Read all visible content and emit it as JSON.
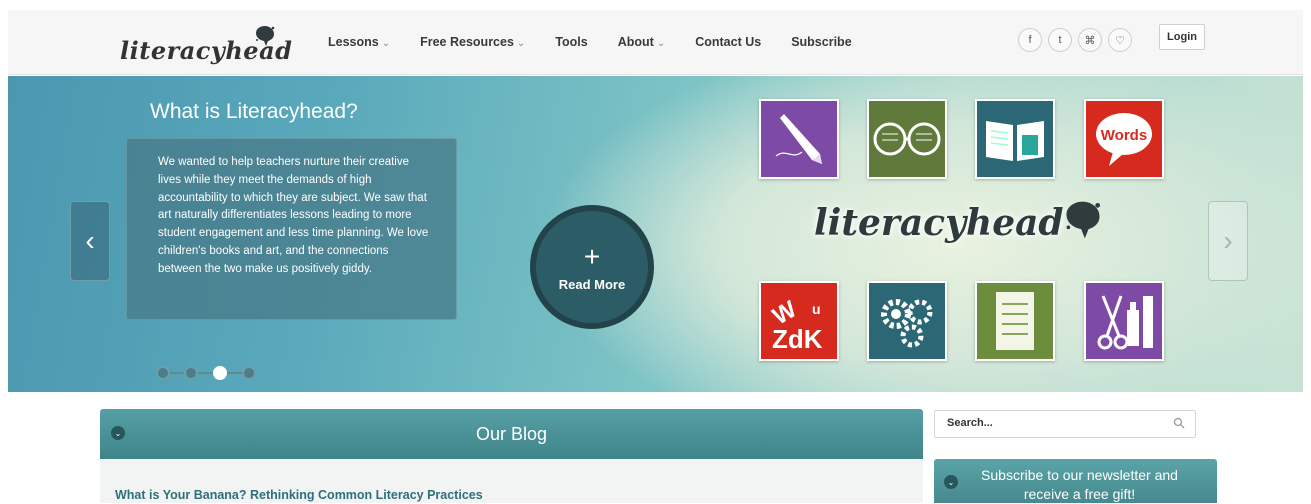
{
  "header": {
    "logo_text": "literacyhead",
    "nav": [
      {
        "label": "Lessons",
        "dropdown": true
      },
      {
        "label": "Free Resources",
        "dropdown": true
      },
      {
        "label": "Tools",
        "dropdown": false
      },
      {
        "label": "About",
        "dropdown": true
      },
      {
        "label": "Contact Us",
        "dropdown": false
      },
      {
        "label": "Subscribe",
        "dropdown": false
      }
    ],
    "social_icons": [
      "facebook-icon",
      "twitter-icon",
      "rss-icon",
      "pinterest-icon"
    ],
    "social_glyphs": [
      "f",
      "t",
      "⌘",
      "♡"
    ],
    "login_label": "Login",
    "dropdown_caret": "⌄"
  },
  "hero": {
    "title": "What is Literacyhead?",
    "body": "We wanted to help teachers nurture their creative lives while they meet the demands of high accountability to which they are subject. We saw that art naturally differentiates lessons leading to more student engagement and less time planning. We love children's books and art, and the connections between the two make us positively giddy.",
    "read_more_plus": "+",
    "read_more_label": "Read More",
    "prev_arrow": "‹",
    "next_arrow": "›",
    "brand_text": "literacyhead",
    "slides_total": 4,
    "active_slide": 3,
    "tiles": [
      {
        "name": "pencil-tile",
        "color": "#7d4ba6"
      },
      {
        "name": "glasses-tile",
        "color": "#5f7a3a"
      },
      {
        "name": "book-tile",
        "color": "#2c6775"
      },
      {
        "name": "words-tile",
        "color": "#d62a1e",
        "label": "Words"
      },
      {
        "name": "letters-tile",
        "color": "#d62a1e",
        "label": "ZdK"
      },
      {
        "name": "gears-tile",
        "color": "#2c6775"
      },
      {
        "name": "checklist-tile",
        "color": "#6c8c3e"
      },
      {
        "name": "scissors-glue-tile",
        "color": "#7d4ba6"
      }
    ]
  },
  "blog": {
    "title": "Our Blog",
    "toggle_glyph": "⌄",
    "first_post_title": "What is Your Banana? Rethinking Common Literacy Practices"
  },
  "sidebar": {
    "search_placeholder": "Search...",
    "newsletter_text": "Subscribe to our newsletter and receive a free gift!"
  },
  "colors": {
    "teal_accent": "#3f8489",
    "link_teal": "#2e6f7c",
    "dark_teal": "#2c5d67"
  }
}
